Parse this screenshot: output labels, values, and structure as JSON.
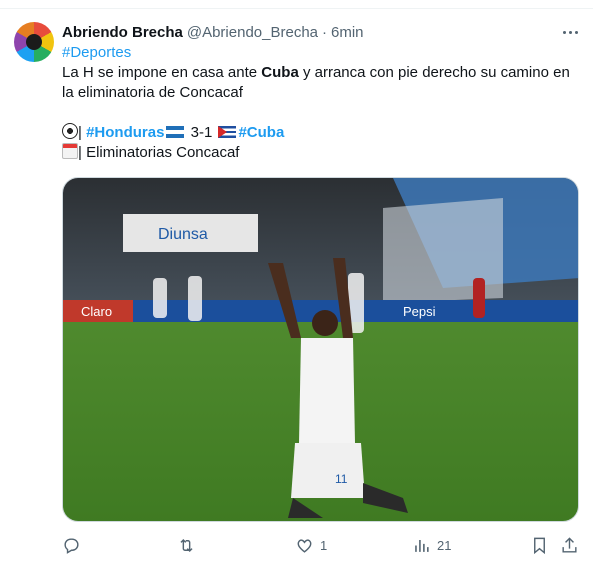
{
  "tweet": {
    "display_name": "Abriendo Brecha",
    "handle": "@Abriendo_Brecha",
    "separator": "·",
    "time": "6min",
    "hashtag_sport": "#Deportes",
    "line1_a": "La H se impone en casa ante ",
    "line1_bold": "Cuba",
    "line1_b": " y arranca con pie derecho su camino en",
    "line2": "la eliminatoria de Concacaf",
    "score_sep": "| ",
    "team_home": "#Honduras",
    "score": " 3-1 ",
    "team_away": "#Cuba",
    "cal_sep": "| ",
    "competition": "Eliminatorias Concacaf"
  },
  "media": {
    "banner_left": "Claro",
    "banner_mid": "Diunsa",
    "banner_right": "Pepsi",
    "jersey_number": "11"
  },
  "actions": {
    "reply_count": "",
    "retweet_count": "",
    "like_count": "1",
    "views_count": "21"
  },
  "icons": {
    "more": "more-icon",
    "reply": "reply-icon",
    "retweet": "retweet-icon",
    "like": "heart-icon",
    "views": "views-icon",
    "bookmark": "bookmark-icon",
    "share": "share-icon"
  },
  "colors": {
    "accent": "#1d9bf0",
    "text": "#0f1419",
    "muted": "#536471",
    "border": "#cfd9de"
  }
}
